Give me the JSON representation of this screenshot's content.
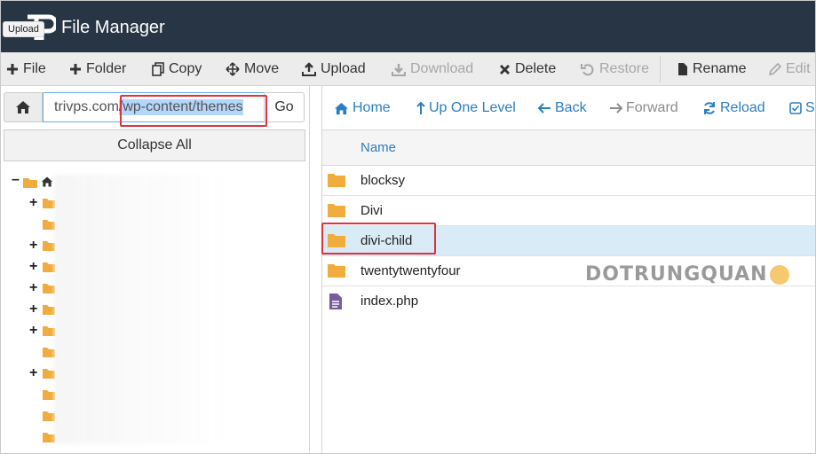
{
  "header": {
    "title": "File Manager",
    "tooltip": "Upload"
  },
  "toolbar": {
    "file": "File",
    "folder": "Folder",
    "copy": "Copy",
    "move": "Move",
    "upload": "Upload",
    "download": "Download",
    "delete": "Delete",
    "restore": "Restore",
    "rename": "Rename",
    "edit": "Edit"
  },
  "left": {
    "path_domain": "trivps.com",
    "path_selected": "/wp-content/themes",
    "go": "Go",
    "collapse_all": "Collapse All"
  },
  "nav": {
    "home": "Home",
    "up": "Up One Level",
    "back": "Back",
    "forward": "Forward",
    "reload": "Reload",
    "select": "Se"
  },
  "table": {
    "name_header": "Name",
    "files": [
      {
        "name": "blocksy",
        "type": "folder"
      },
      {
        "name": "Divi",
        "type": "folder"
      },
      {
        "name": "divi-child",
        "type": "folder"
      },
      {
        "name": "twentytwentyfour",
        "type": "folder"
      },
      {
        "name": "index.php",
        "type": "file"
      }
    ]
  },
  "watermark": "DOTRUNGQUAN",
  "colors": {
    "header_bg": "#283545",
    "link": "#2b7ec1",
    "folder": "#f0ac3c",
    "highlight": "#e0323e",
    "selected_row": "#d9ebf7"
  }
}
